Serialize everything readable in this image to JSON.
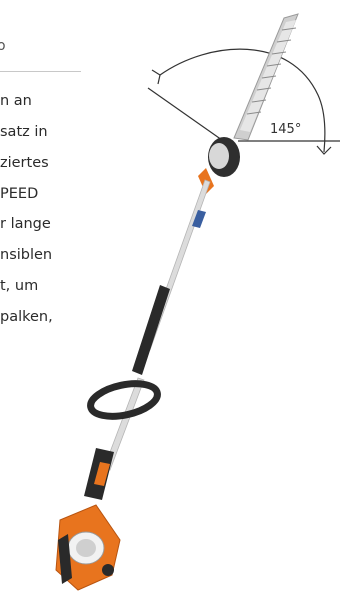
{
  "text_panel": {
    "heading_fragment": "o",
    "lines": [
      "n an",
      "satz in",
      "ziertes",
      "PEED",
      "r lange",
      "nsiblen",
      "t, um",
      "palken,"
    ]
  },
  "product_image": {
    "angle_label": "145°",
    "icons": [
      "angle-arc-icon"
    ],
    "colors": {
      "body_orange": "#e8741e",
      "shaft": "#dcdcdc",
      "grip": "#2a2a2a",
      "accent_blue": "#3a5fa0"
    }
  }
}
